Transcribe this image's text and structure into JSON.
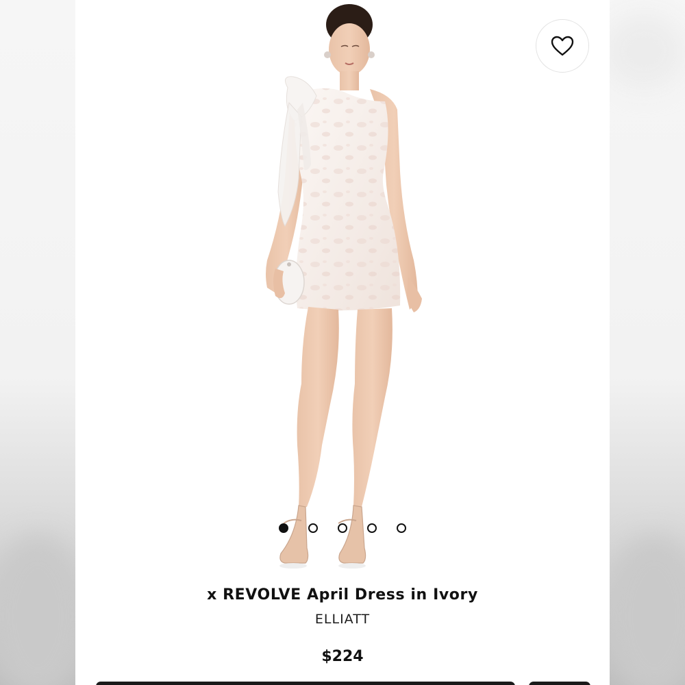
{
  "product": {
    "title": "x REVOLVE April Dress in Ivory",
    "brand": "ELLIATT",
    "price": "$224",
    "image_alt": "Model wearing ivory one-shoulder jacquard mini dress with bow"
  },
  "favorite": {
    "icon": "heart-outline-icon"
  },
  "carousel": {
    "total": 5,
    "active_index": 0
  },
  "colors": {
    "text": "#111111",
    "dot_active": "#111111"
  }
}
